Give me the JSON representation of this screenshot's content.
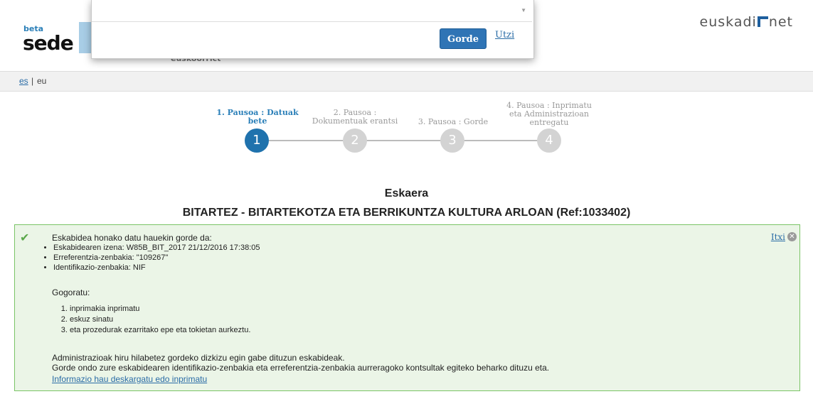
{
  "header": {
    "logo_beta": "beta",
    "logo_sede": "sede",
    "behind_text": "euskoorrict",
    "brand_left": "euskadi",
    "brand_right": "net"
  },
  "language": {
    "es": "es",
    "separator": "|",
    "eu": "eu"
  },
  "modal": {
    "save_label": "Gorde",
    "cancel_label": "Utzi"
  },
  "steps": [
    {
      "number": "1",
      "label": "1. Pausoa : Datuak bete",
      "active": true
    },
    {
      "number": "2",
      "label": "2. Pausoa : Dokumentuak erantsi",
      "active": false
    },
    {
      "number": "3",
      "label": "3. Pausoa : Gorde",
      "active": false
    },
    {
      "number": "4",
      "label": "4. Pausoa : Inprimatu eta Administrazioan entregatu",
      "active": false
    }
  ],
  "page": {
    "title": "Eskaera",
    "subtitle": "BITARTEZ - BITARTEKOTZA ETA BERRIKUNTZA KULTURA ARLOAN (Ref:1033402)"
  },
  "success": {
    "close_label": "Itxi",
    "intro": "Eskabidea honako datu hauekin gorde da:",
    "items": [
      "Eskabidearen izena: W85B_BIT_2017 21/12/2016 17:38:05",
      "Erreferentzia-zenbakia: \"109267\"",
      "Identifikazio-zenbakia: NIF"
    ],
    "reminder_title": "Gogoratu:",
    "reminders": [
      "inprimakia inprimatu",
      "eskuz sinatu",
      "eta prozedurak ezarritako epe eta tokietan aurkeztu."
    ],
    "admin_line1": "Administrazioak hiru hilabetez gordeko dizkizu egin gabe dituzun eskabideak.",
    "admin_line2": "Gorde ondo zure eskabidearen identifikazio-zenbakia eta erreferentzia-zenbakia aurreragoko kontsultak egiteko beharko dituzu eta.",
    "download_link": "Informazio hau deskargatu edo inprimatu"
  },
  "colors": {
    "accent": "#1f72ad",
    "success_bg": "#ebf5e7",
    "success_border": "#7ac466",
    "inactive_step": "#d3d3d3"
  }
}
